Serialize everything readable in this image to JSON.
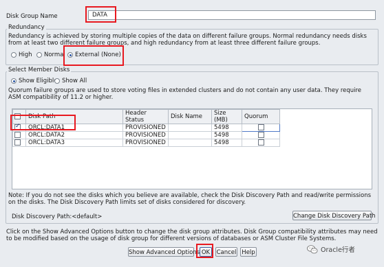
{
  "disk_group_name": {
    "label": "Disk Group Name",
    "value": "DATA"
  },
  "redundancy": {
    "legend": "Redundancy",
    "description": "Redundancy is achieved by storing multiple copies of the data on different failure groups. Normal redundancy needs disks from at least two different failure groups, and high redundancy from at least three different failure groups.",
    "options": [
      {
        "label": "High",
        "selected": false
      },
      {
        "label": "Normal",
        "selected": false
      },
      {
        "label": "External (None)",
        "selected": true
      }
    ]
  },
  "member_disks": {
    "legend": "Select Member Disks",
    "filters": [
      {
        "label": "Show Eligible",
        "selected": true
      },
      {
        "label": "Show All",
        "selected": false
      }
    ],
    "quorum_note": "Quorum failure groups are used to store voting files in extended clusters and do not contain any user data. They require ASM compatibility of 11.2 or higher.",
    "columns": [
      "",
      "Disk Path",
      "Header Status",
      "Disk Name",
      "Size (MB)",
      "Quorum"
    ],
    "rows": [
      {
        "checked": true,
        "path": "ORCL:DATA1",
        "status": "PROVISIONED",
        "name": "",
        "size": "5498",
        "quorum": false
      },
      {
        "checked": false,
        "path": "ORCL:DATA2",
        "status": "PROVISIONED",
        "name": "",
        "size": "5498",
        "quorum": false
      },
      {
        "checked": false,
        "path": "ORCL:DATA3",
        "status": "PROVISIONED",
        "name": "",
        "size": "5498",
        "quorum": false
      }
    ],
    "note": "Note: If you do not see the disks which you believe are available, check the Disk Discovery Path and read/write permissions on the disks. The Disk Discovery Path limits set of disks considered for discovery.",
    "discovery_path": "Disk Discovery Path:<default>",
    "change_path_button": "Change Disk Discovery Path"
  },
  "footer": {
    "info": "Click on the Show Advanced Options button to change the disk group attributes. Disk Group compatibility attributes may need to be modified based on the usage of disk group for different versions of databases or ASM Cluster File Systems.",
    "show_advanced_button": "Show Advanced Options",
    "ok_button": "OK",
    "cancel_button": "Cancel",
    "help_button": "Help"
  },
  "watermark": {
    "text": "Oracle行者",
    "icon": "wechat-icon"
  },
  "colors": {
    "annotation": "#e8181f",
    "selection": "#2a57a6"
  }
}
